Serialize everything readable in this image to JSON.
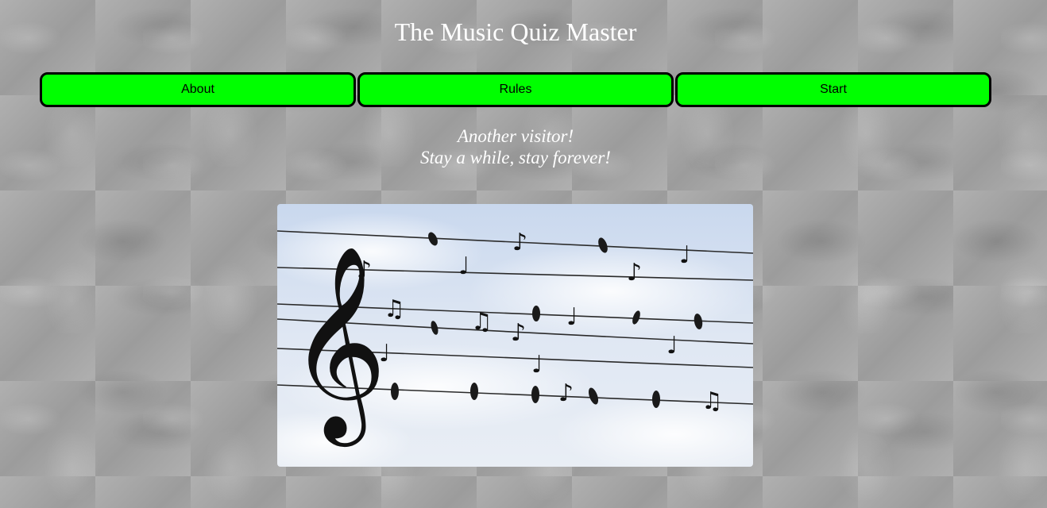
{
  "header": {
    "title": "The Music Quiz Master"
  },
  "nav": {
    "items": [
      {
        "label": "About"
      },
      {
        "label": "Rules"
      },
      {
        "label": "Start"
      }
    ]
  },
  "greeting": {
    "line1": "Another visitor!",
    "line2": "Stay a while, stay forever!"
  },
  "hero": {
    "image": "birds-on-wires-music-staff",
    "treble_clef": "𝄞",
    "notes": [
      "♪",
      "♩",
      "♫"
    ]
  },
  "colors": {
    "nav_button": "#00ff00",
    "nav_border": "#000000",
    "text_light": "#ffffff",
    "background": "#a9a9a9"
  }
}
